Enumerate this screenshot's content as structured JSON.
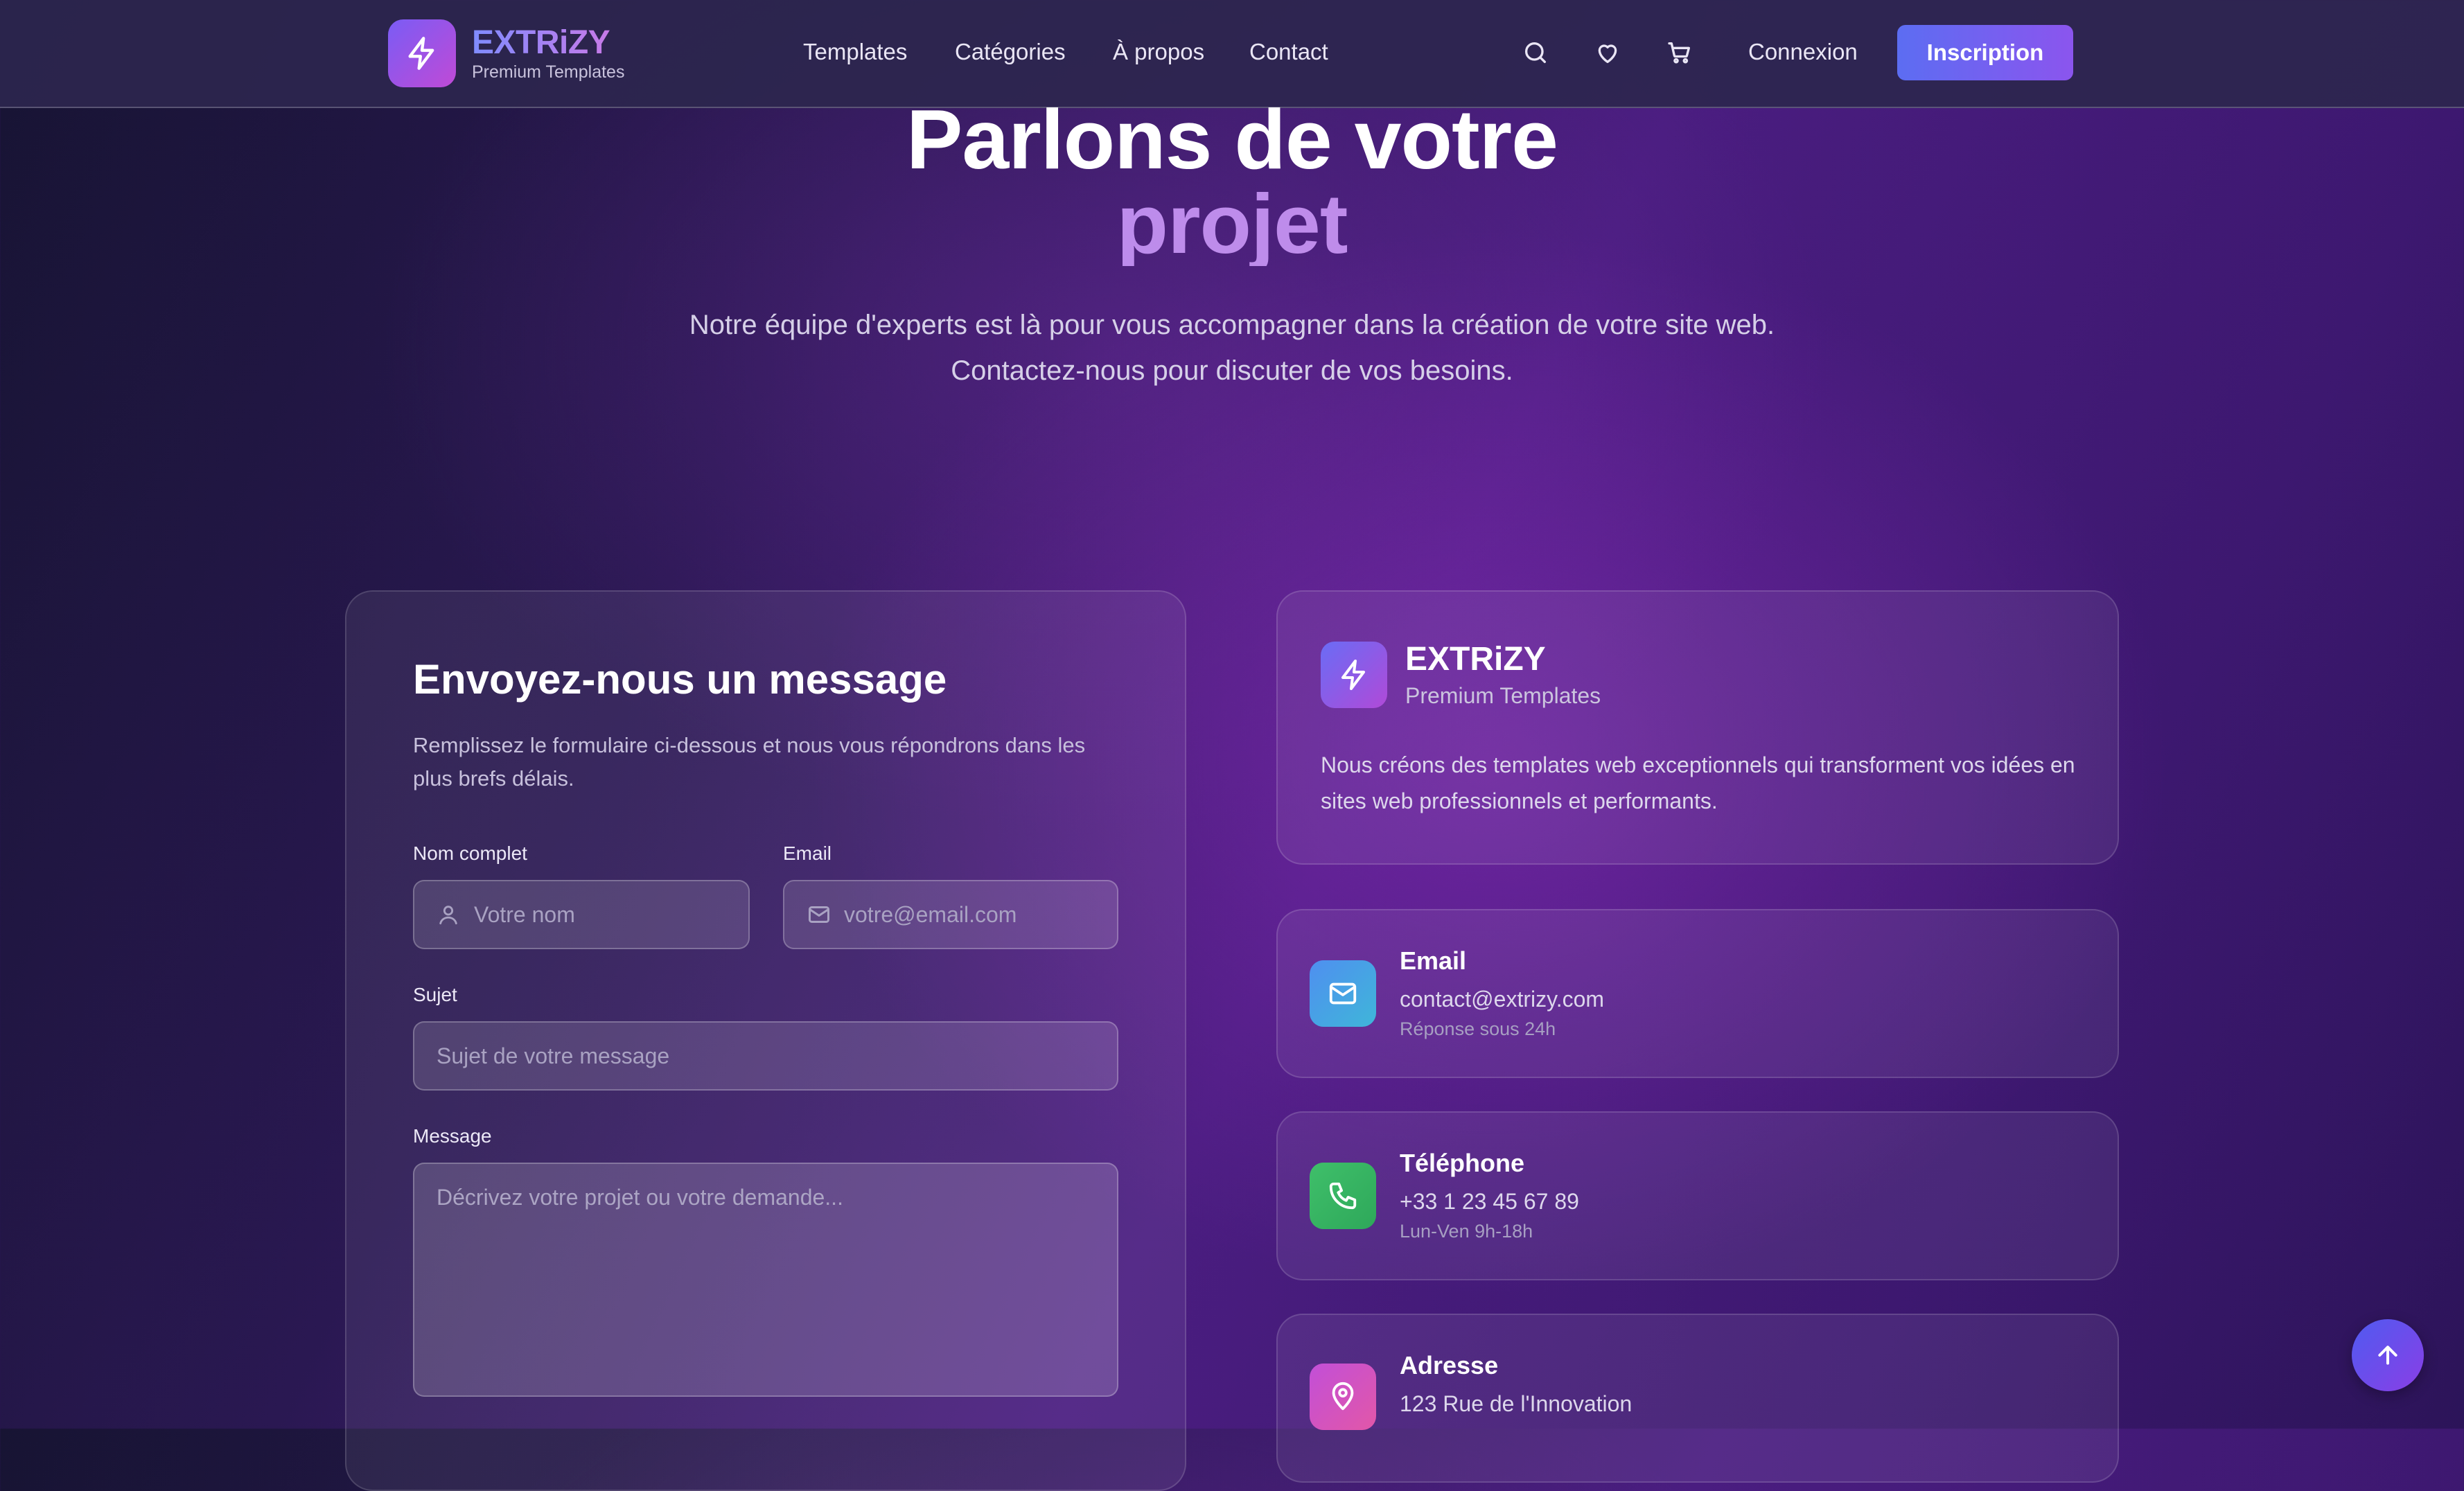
{
  "nav": {
    "brand_name": "EXTRiZY",
    "brand_sub": "Premium Templates",
    "links": [
      "Templates",
      "Catégories",
      "À propos",
      "Contact"
    ],
    "icons": [
      "search-icon",
      "heart-icon",
      "cart-icon"
    ],
    "login": "Connexion",
    "signup": "Inscription"
  },
  "hero": {
    "title_line1": "Parlons de votre",
    "title_line2": "projet",
    "description": "Notre équipe d'experts est là pour vous accompagner dans la création de votre site web. Contactez-nous pour discuter de vos besoins."
  },
  "form": {
    "title": "Envoyez-nous un message",
    "description": "Remplissez le formulaire ci-dessous et nous vous répondrons dans les plus brefs délais.",
    "name_label": "Nom complet",
    "name_placeholder": "Votre nom",
    "email_label": "Email",
    "email_placeholder": "votre@email.com",
    "subject_label": "Sujet",
    "subject_placeholder": "Sujet de votre message",
    "message_label": "Message",
    "message_placeholder": "Décrivez votre projet ou votre demande..."
  },
  "company": {
    "name": "EXTRiZY",
    "sub": "Premium Templates",
    "description": "Nous créons des templates web exceptionnels qui transforment vos idées en sites web professionnels et performants."
  },
  "contacts": [
    {
      "title": "Email",
      "value": "contact@extrizy.com",
      "note": "Réponse sous 24h",
      "icon": "mail-icon",
      "color": "#4f8ff0"
    },
    {
      "title": "Téléphone",
      "value": "+33 1 23 45 67 89",
      "note": "Lun-Ven 9h-18h",
      "icon": "phone-icon",
      "color": "#3cb56a"
    },
    {
      "title": "Adresse",
      "value": "123 Rue de l'Innovation",
      "note": "",
      "icon": "map-pin-icon",
      "color": "#c04ad6"
    }
  ],
  "colors": {
    "accent": "#6f5cf0",
    "brand_gradient_start": "#7f8cff",
    "brand_gradient_end": "#c77ae8"
  }
}
